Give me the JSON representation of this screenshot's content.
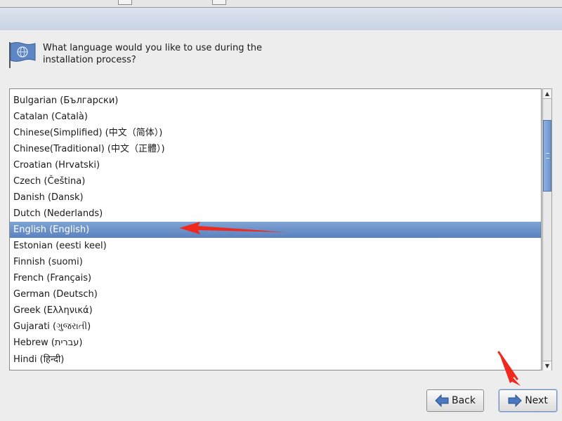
{
  "header": {
    "question": "What language would you like to use during the installation process?"
  },
  "languages": [
    {
      "label": "Bulgarian (Български)"
    },
    {
      "label": "Catalan (Català)"
    },
    {
      "label": "Chinese(Simplified) (中文（简体）)"
    },
    {
      "label": "Chinese(Traditional) (中文（正體）)"
    },
    {
      "label": "Croatian (Hrvatski)"
    },
    {
      "label": "Czech (Čeština)"
    },
    {
      "label": "Danish (Dansk)"
    },
    {
      "label": "Dutch (Nederlands)"
    },
    {
      "label": "English (English)",
      "selected": true
    },
    {
      "label": "Estonian (eesti keel)"
    },
    {
      "label": "Finnish (suomi)"
    },
    {
      "label": "French (Français)"
    },
    {
      "label": "German (Deutsch)"
    },
    {
      "label": "Greek (Ελληνικά)"
    },
    {
      "label": "Gujarati (ગુજરાતી)"
    },
    {
      "label": "Hebrew (עברית)"
    },
    {
      "label": "Hindi (हिन्दी)"
    }
  ],
  "buttons": {
    "back_label": "Back",
    "next_label": "Next"
  },
  "colors": {
    "selection": "#6b90c9",
    "annotation_arrow": "#f0281e"
  },
  "icons": {
    "header": "flag-globe-icon",
    "back": "arrow-left-icon",
    "next": "arrow-right-icon"
  }
}
